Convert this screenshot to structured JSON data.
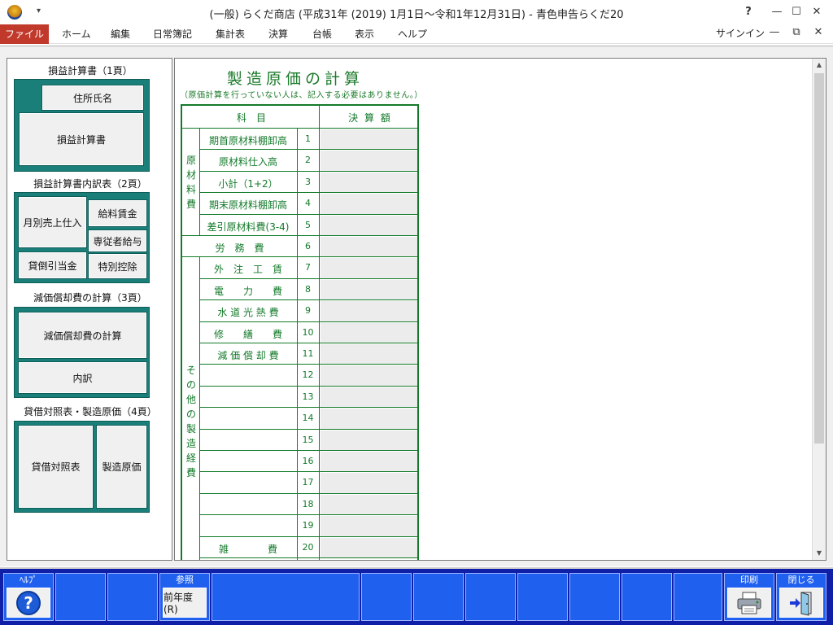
{
  "window": {
    "title": "(一般) らくだ商店 (平成31年 (2019) 1月1日～令和1年12月31日) - 青色申告らくだ20",
    "help": "?",
    "minimize": "—",
    "maximize": "☐",
    "close": "✕",
    "quick_access": "▾"
  },
  "menu": {
    "file": "ファイル",
    "items": [
      "ホーム",
      "編集",
      "日常簿記",
      "集計表",
      "決算",
      "台帳",
      "表示",
      "ヘルプ"
    ],
    "signin": "サインイン",
    "mdi_minimize": "—",
    "mdi_restore": "⧉",
    "mdi_close": "✕"
  },
  "left_panel": {
    "section1_title": "損益計算書（1頁）",
    "section1_btn_address": "住所氏名",
    "section1_btn_pl": "損益計算書",
    "section2_title": "損益計算書内訳表（2頁）",
    "section2_btn_monthly": "月別売上仕入",
    "section2_btn_salary": "給料賃金",
    "section2_btn_family": "専従者給与",
    "section2_btn_allowance": "貸倒引当金",
    "section2_btn_special": "特別控除",
    "section3_title": "減価償却費の計算（3頁）",
    "section3_btn_calc": "減価償却費の計算",
    "section3_btn_detail": "内訳",
    "section4_title": "貸借対照表・製造原価（4頁）",
    "section4_btn_bs": "貸借対照表",
    "section4_btn_mfg": "製造原価"
  },
  "document": {
    "title": "製造原価の計算",
    "subtitle": "（原価計算を行っていない人は、記入する必要はありません。）",
    "header_item": "科　目",
    "header_amount": "決 算 額",
    "group_material": "原材料費",
    "group_other": "その他の製造経費",
    "rows": [
      {
        "label": "期首原材料棚卸高",
        "no": "1"
      },
      {
        "label": "原材料仕入高",
        "no": "2"
      },
      {
        "label": "小計（1+2）",
        "no": "3"
      },
      {
        "label": "期末原材料棚卸高",
        "no": "4"
      },
      {
        "label": "差引原材料費(3-4)",
        "no": "5"
      },
      {
        "label": "労　務　費",
        "no": "6"
      },
      {
        "label": "外　注　工　賃",
        "no": "7"
      },
      {
        "label": "電　　力　　費",
        "no": "8"
      },
      {
        "label": "水 道 光 熱 費",
        "no": "9"
      },
      {
        "label": "修　　繕　　費",
        "no": "10"
      },
      {
        "label": "減 価 償 却 費",
        "no": "11"
      },
      {
        "label": "",
        "no": "12"
      },
      {
        "label": "",
        "no": "13"
      },
      {
        "label": "",
        "no": "14"
      },
      {
        "label": "",
        "no": "15"
      },
      {
        "label": "",
        "no": "16"
      },
      {
        "label": "",
        "no": "17"
      },
      {
        "label": "",
        "no": "18"
      },
      {
        "label": "",
        "no": "19"
      },
      {
        "label": "雑　　　　費",
        "no": "20"
      }
    ]
  },
  "function_bar": {
    "help_label": "ﾍﾙﾌﾟ",
    "help_icon": "?",
    "ref_label": "参照",
    "prev_year": "前年度(R)",
    "print_label": "印刷",
    "close_label": "閉じる"
  },
  "icons": {
    "print": "printer-icon",
    "close": "exit-door-icon",
    "help": "question-circle-icon"
  },
  "colors": {
    "form_green": "#137a2a",
    "nav_teal": "#1b7f79",
    "fbar_dark": "#0f1fa8",
    "fbar_key": "#2060ef",
    "file_menu": "#c0392b"
  }
}
